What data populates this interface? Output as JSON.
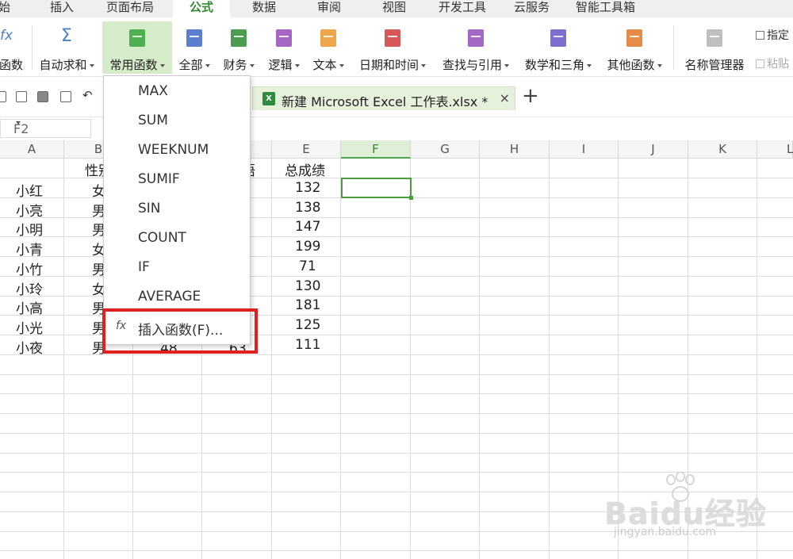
{
  "menu_tabs": [
    "始",
    "插入",
    "页面布局",
    "公式",
    "数据",
    "审阅",
    "视图",
    "开发工具",
    "云服务",
    "智能工具箱"
  ],
  "active_menu_tab": "公式",
  "ribbon": {
    "insert_function_label": "函数",
    "autosum_label": "自动求和",
    "common_functions_label": "常用函数",
    "all_label": "全部",
    "finance_label": "财务",
    "logic_label": "逻辑",
    "text_label": "文本",
    "datetime_label": "日期和时间",
    "lookup_label": "查找与引用",
    "math_label": "数学和三角",
    "other_label": "其他函数",
    "name_manager_label": "名称管理器",
    "specify_label": "指定",
    "paste_label": "粘贴",
    "colors": {
      "common": "#4fb04f",
      "all": "#5b7fd0",
      "finance": "#4b9b50",
      "logic": "#a667c4",
      "text": "#eea64a",
      "datetime": "#d85858",
      "lookup": "#a667c4",
      "math": "#7c6fd0",
      "other": "#e68b4a",
      "name_manager": "#bfbfbf"
    }
  },
  "document_tab": {
    "title": "新建 Microsoft Excel 工作表.xlsx *",
    "close": "×",
    "add": "+"
  },
  "name_box": {
    "value": "F2"
  },
  "columns": [
    "A",
    "B",
    "C",
    "D",
    "E",
    "F",
    "G",
    "H",
    "I",
    "J",
    "K",
    "L"
  ],
  "active_column": "F",
  "cells": {
    "header_b": "性别",
    "header_d": "英语",
    "header_e": "总成绩",
    "names": [
      "小红",
      "小亮",
      "小明",
      "小青",
      "小竹",
      "小玲",
      "小高",
      "小光",
      "小夜"
    ],
    "genders": [
      "女",
      "男",
      "男",
      "女",
      "男",
      "女",
      "男",
      "男",
      "男"
    ],
    "totals": [
      "132",
      "138",
      "147",
      "199",
      "71",
      "130",
      "181",
      "125",
      "111"
    ],
    "last_row_c": "48",
    "last_row_d": "63"
  },
  "dropdown": {
    "items": [
      "MAX",
      "SUM",
      "WEEKNUM",
      "SUMIF",
      "SIN",
      "COUNT",
      "IF",
      "AVERAGE"
    ],
    "insert_function": "插入函数(F)...",
    "insert_function_icon": "fx"
  },
  "watermark": {
    "logo": "Baidu经验",
    "url": "jingyan.baidu.com"
  }
}
